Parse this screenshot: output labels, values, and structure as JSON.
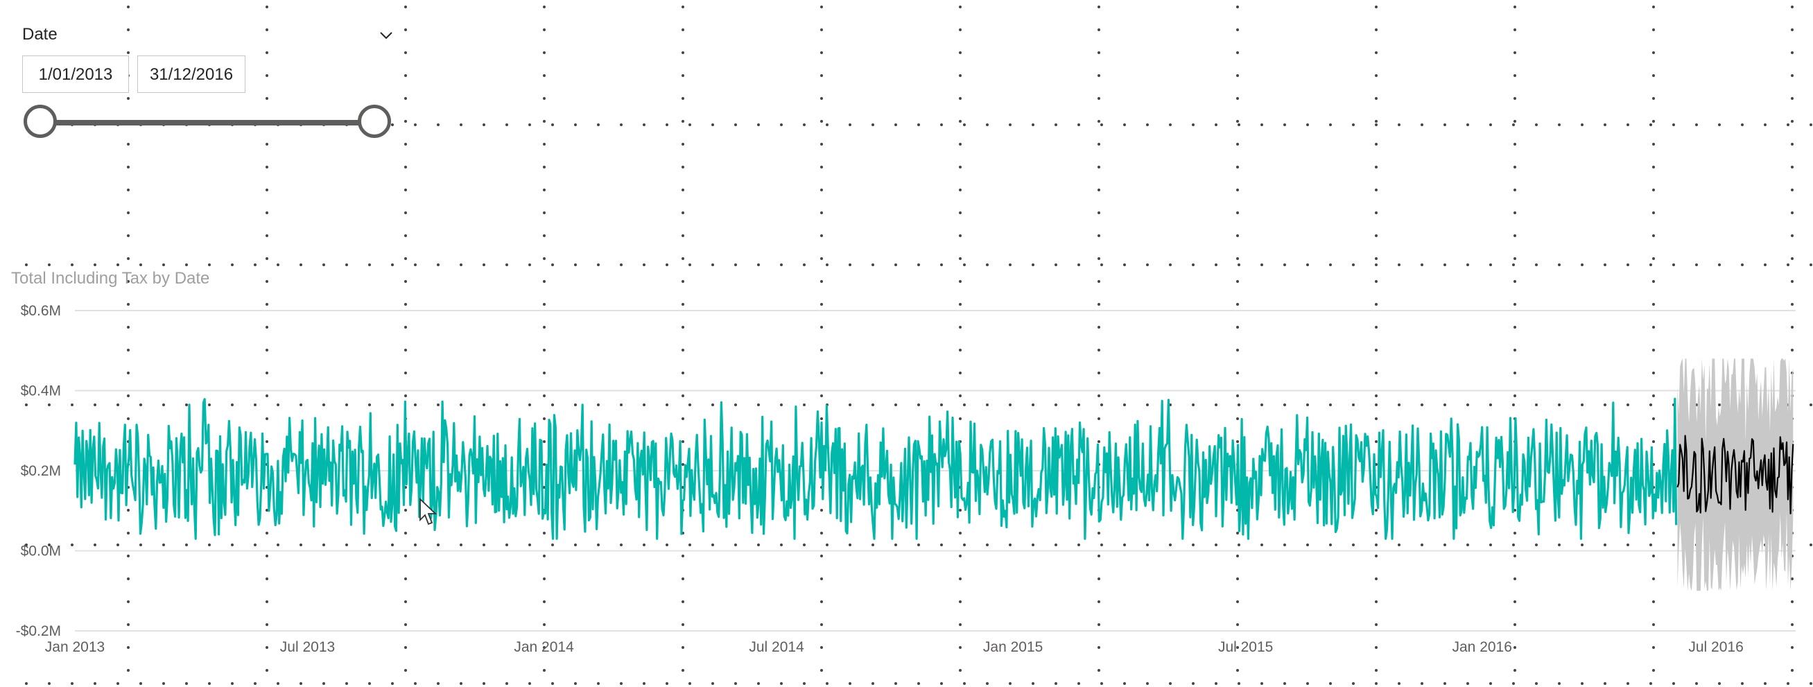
{
  "slicer": {
    "title": "Date",
    "start_date": "1/01/2013",
    "end_date": "31/12/2016",
    "range_selected_fraction": [
      0,
      1
    ]
  },
  "colors": {
    "actual": "#01B8AA",
    "forecast": "#000000",
    "confidence_band": "#C8C8C8",
    "gridline": "#E1E1E1",
    "axis_text": "#605E5C",
    "title_text": "#A19F9D"
  },
  "chart_data": {
    "type": "line",
    "title": "Total Including Tax by Date",
    "xlabel": "",
    "ylabel": "",
    "ylim": [
      -0.2,
      0.6
    ],
    "y_unit": "$M",
    "y_ticks": [
      "$0.6M",
      "$0.4M",
      "$0.2M",
      "$0.0M",
      "-$0.2M"
    ],
    "x_range": [
      "2013-01-01",
      "2016-09-01"
    ],
    "x_ticks": [
      "Jan 2013",
      "Jul 2013",
      "Jan 2014",
      "Jul 2014",
      "Jan 2015",
      "Jul 2015",
      "Jan 2016",
      "Jul 2016"
    ],
    "x_tick_dates": [
      "2013-01-01",
      "2013-07-01",
      "2014-01-01",
      "2014-07-01",
      "2015-01-01",
      "2015-07-01",
      "2016-01-01",
      "2016-07-01"
    ],
    "series": [
      {
        "values_kind": "actual",
        "start": "2013-01-01",
        "end": "2016-05-31",
        "mean": 0.19,
        "min": 0.03,
        "max": 0.38
      },
      {
        "values_kind": "forecast",
        "start": "2016-06-01",
        "end": "2016-08-30",
        "mean": 0.19,
        "lower_bound_min": -0.1,
        "upper_bound_max": 0.48
      }
    ],
    "grid": true,
    "legend": "none"
  }
}
